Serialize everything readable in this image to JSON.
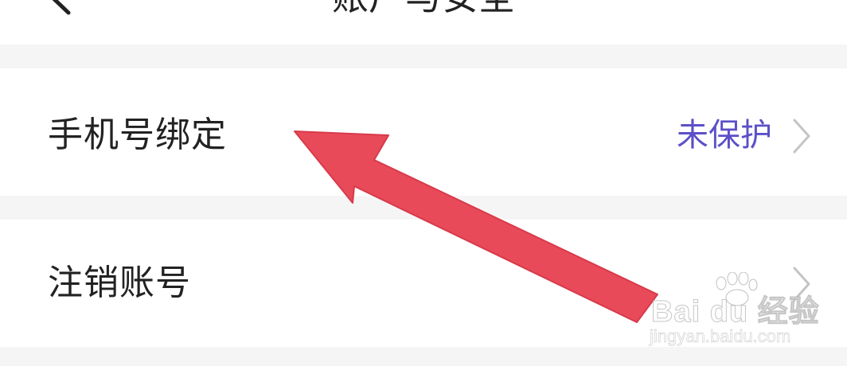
{
  "header": {
    "title": "账户与安全",
    "back_icon": "chevron-left-icon"
  },
  "rows": [
    {
      "label": "手机号绑定",
      "value": "未保护",
      "icon": "chevron-right-icon"
    },
    {
      "label": "注销账号",
      "icon": "chevron-right-icon"
    }
  ],
  "annotation": {
    "icon": "arrow-annotation-icon",
    "color": "#e84a5a"
  },
  "watermark": {
    "logo_text": "Bai du 经验",
    "sub_text": "jingyan.baidu.com"
  },
  "colors": {
    "status_value": "#5c50c8",
    "background": "#f5f5f5",
    "row_background": "#ffffff"
  }
}
